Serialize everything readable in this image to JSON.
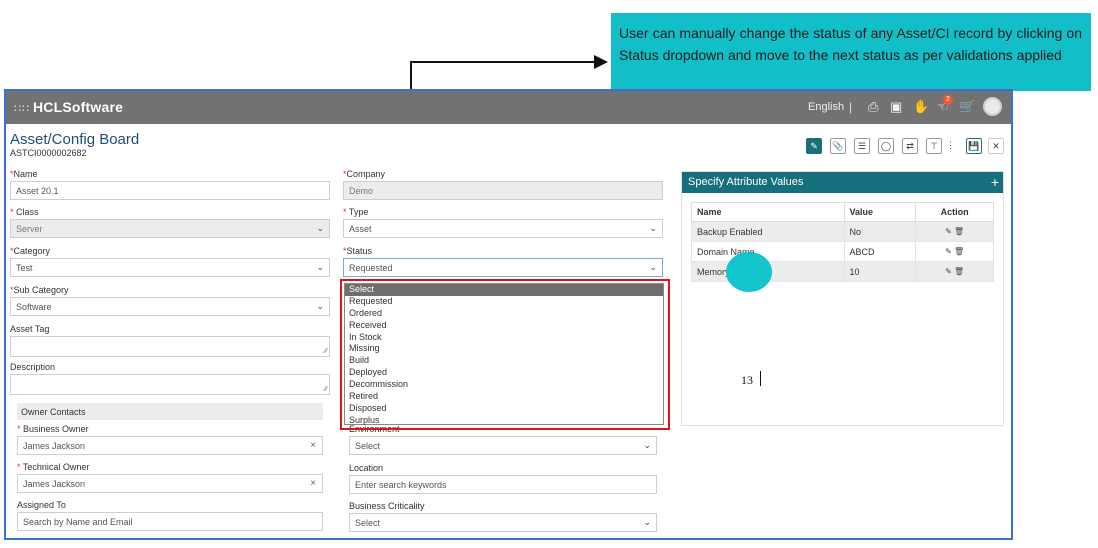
{
  "callout": {
    "text": "User can manually change the status of any Asset/CI record by clicking on Status dropdown and move to the next status as per validations applied"
  },
  "topbar": {
    "brand": "HCLSoftware",
    "language": "English",
    "separator": "|",
    "notification_count": "2",
    "icons": [
      "grid-icon",
      "document-icon",
      "approval-icon",
      "hand-icon",
      "thumbs-icon",
      "cart-icon",
      "user-avatar-icon"
    ]
  },
  "page": {
    "title": "Asset/Config Board",
    "record_id": "ASTCI0000002682"
  },
  "toolbar": {
    "icons": [
      "edit-icon",
      "attachment-icon",
      "note-icon",
      "tag-icon",
      "relationship-icon",
      "hierarchy-icon",
      "more-icon",
      "save-icon",
      "close-icon"
    ]
  },
  "form": {
    "name_label": "Name",
    "name_value": "Asset 20.1",
    "company_label": "Company",
    "company_value": "Demo",
    "class_label": "Class",
    "class_value": "Server",
    "type_label": "Type",
    "type_value": "Asset",
    "category_label": "Category",
    "category_value": "Test",
    "status_label": "Status",
    "status_value": "Requested",
    "subcategory_label": "Sub Category",
    "subcategory_value": "Software",
    "asset_tag_label": "Asset Tag",
    "description_label": "Description",
    "owner_contacts": "Owner Contacts",
    "business_owner_label": "Business Owner",
    "business_owner_value": "James Jackson",
    "technical_owner_label": "Technical Owner",
    "technical_owner_value": "James Jackson",
    "assigned_to_label": "Assigned To",
    "assigned_to_placeholder": "Search by Name and Email",
    "environment_label": "Environment",
    "environment_value": "Select",
    "location_label": "Location",
    "location_placeholder": "Enter search keywords",
    "criticality_label": "Business Criticality",
    "criticality_value": "Select",
    "required_mark": "*"
  },
  "status_dropdown": {
    "selected": "Select",
    "options": [
      "Select",
      "Requested",
      "Ordered",
      "Received",
      "In Stock",
      "Missing",
      "Build",
      "Deployed",
      "Decommission",
      "Retired",
      "Disposed",
      "Surplus"
    ]
  },
  "attributes": {
    "title": "Specify Attribute Values",
    "add": "+",
    "headers": [
      "Name",
      "Value",
      "Action"
    ],
    "rows": [
      {
        "name": "Backup Enabled",
        "value": "No"
      },
      {
        "name": "Domain Name",
        "value": "ABCD"
      },
      {
        "name": "Memory",
        "value": "10"
      }
    ]
  },
  "page_number": "13",
  "colors": {
    "callout": "#12bfc9",
    "topbar": "#727272",
    "panel_header": "#156f7c",
    "highlight_border": "#e01515",
    "frame_border": "#3d6fd2"
  }
}
